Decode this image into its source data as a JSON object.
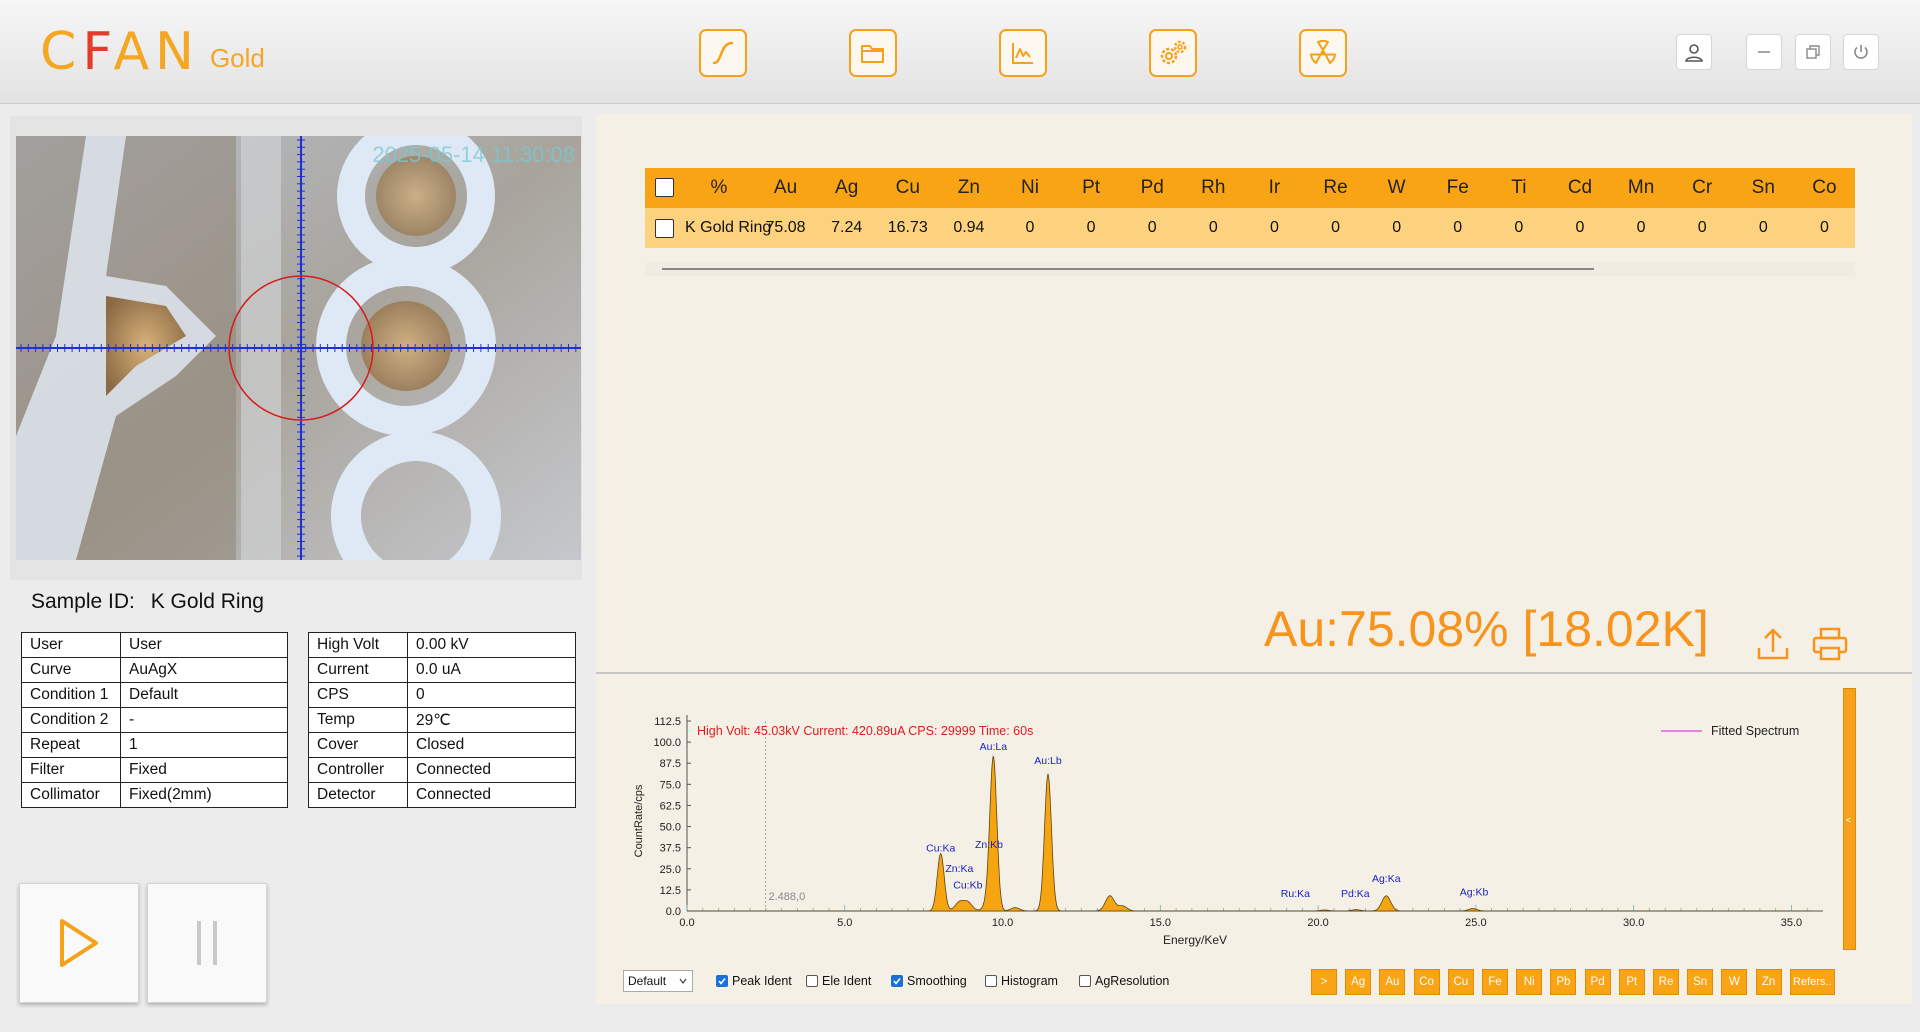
{
  "header": {
    "logo_main": "CFAN",
    "logo_sub": "Gold"
  },
  "nav": [
    {
      "name": "curve-icon"
    },
    {
      "name": "folder-icon"
    },
    {
      "name": "spectrum-icon"
    },
    {
      "name": "settings-icon"
    },
    {
      "name": "radiation-icon"
    }
  ],
  "camera": {
    "timestamp": "2025-05-14 11:30:08"
  },
  "sample": {
    "label": "Sample ID:",
    "value": "K Gold Ring"
  },
  "info_left": [
    {
      "k": "User",
      "v": "User"
    },
    {
      "k": "Curve",
      "v": "AuAgX"
    },
    {
      "k": "Condition 1",
      "v": "Default"
    },
    {
      "k": "Condition 2",
      "v": "-"
    },
    {
      "k": "Repeat",
      "v": "1"
    },
    {
      "k": "Filter",
      "v": "Fixed"
    },
    {
      "k": "Collimator",
      "v": "Fixed(2mm)"
    }
  ],
  "info_right": [
    {
      "k": "High Volt",
      "v": "0.00 kV"
    },
    {
      "k": "Current",
      "v": "0.0 uA"
    },
    {
      "k": "CPS",
      "v": "0"
    },
    {
      "k": "Temp",
      "v": "29℃"
    },
    {
      "k": "Cover",
      "v": "Closed"
    },
    {
      "k": "Controller",
      "v": "Connected"
    },
    {
      "k": "Detector",
      "v": "Connected"
    }
  ],
  "results": {
    "pct_header": "%",
    "columns": [
      "Au",
      "Ag",
      "Cu",
      "Zn",
      "Ni",
      "Pt",
      "Pd",
      "Rh",
      "Ir",
      "Re",
      "W",
      "Fe",
      "Ti",
      "Cd",
      "Mn",
      "Cr",
      "Sn",
      "Co"
    ],
    "rows": [
      {
        "name": "K Gold Ring",
        "values": [
          "75.08",
          "7.24",
          "16.73",
          "0.94",
          "0",
          "0",
          "0",
          "0",
          "0",
          "0",
          "0",
          "0",
          "0",
          "0",
          "0",
          "0",
          "0",
          "0"
        ]
      }
    ]
  },
  "big_result": "Au:75.08%  [18.02K]",
  "controls": {
    "select_value": "Default",
    "checkboxes": [
      {
        "label": "Peak Ident",
        "checked": true
      },
      {
        "label": "Ele Ident",
        "checked": false
      },
      {
        "label": "Smoothing",
        "checked": true
      },
      {
        "label": "Histogram",
        "checked": false
      },
      {
        "label": "AgResolution",
        "checked": false
      }
    ],
    "element_buttons": [
      ">",
      "Ag",
      "Au",
      "Co",
      "Cu",
      "Fe",
      "Ni",
      "Pb",
      "Pd",
      "Pt",
      "Re",
      "Sn",
      "W",
      "Zn",
      "Refers.."
    ]
  },
  "chart_data": {
    "type": "line",
    "title": "High Volt: 45.03kV  Current: 420.89uA  CPS: 29999  Time: 60s",
    "xlabel": "Energy/KeV",
    "ylabel": "CountRate/cps",
    "xlim": [
      0,
      36
    ],
    "ylim": [
      0,
      112.5
    ],
    "xticks": [
      "0.0",
      "5.0",
      "10.0",
      "15.0",
      "20.0",
      "25.0",
      "30.0",
      "35.0"
    ],
    "yticks": [
      "0.0",
      "12.5",
      "25.0",
      "37.5",
      "50.0",
      "62.5",
      "75.0",
      "87.5",
      "100.0",
      "112.5"
    ],
    "cursor_label": "2.488,0",
    "cursor_x": 2.488,
    "legend": "Fitted Spectrum",
    "legend_position": "top-right",
    "series": [
      {
        "name": "Fitted Spectrum",
        "peaks": [
          {
            "x": 8.04,
            "y": 34
          },
          {
            "x": 8.63,
            "y": 5
          },
          {
            "x": 8.9,
            "y": 5
          },
          {
            "x": 9.57,
            "y": 6
          },
          {
            "x": 9.71,
            "y": 88
          },
          {
            "x": 10.4,
            "y": 2
          },
          {
            "x": 11.44,
            "y": 81
          },
          {
            "x": 13.4,
            "y": 9
          },
          {
            "x": 13.8,
            "y": 3
          },
          {
            "x": 20.2,
            "y": 0.6
          },
          {
            "x": 21.2,
            "y": 0.8
          },
          {
            "x": 22.16,
            "y": 9
          },
          {
            "x": 24.9,
            "y": 1.4
          }
        ]
      }
    ],
    "annotations": [
      {
        "label": "Cu:Ka",
        "x": 8.04,
        "y": 34
      },
      {
        "label": "Zn:Ka",
        "x": 8.63,
        "y": 22
      },
      {
        "label": "Cu:Kb",
        "x": 8.9,
        "y": 12
      },
      {
        "label": "Zn:Kb",
        "x": 9.57,
        "y": 36
      },
      {
        "label": "Au:La",
        "x": 9.71,
        "y": 94
      },
      {
        "label": "Au:Lb",
        "x": 11.44,
        "y": 86
      },
      {
        "label": "Ru:Ka",
        "x": 19.28,
        "y": 7
      },
      {
        "label": "Pd:Ka",
        "x": 21.18,
        "y": 7
      },
      {
        "label": "Ag:Ka",
        "x": 22.16,
        "y": 16
      },
      {
        "label": "Ag:Kb",
        "x": 24.94,
        "y": 8
      }
    ]
  }
}
